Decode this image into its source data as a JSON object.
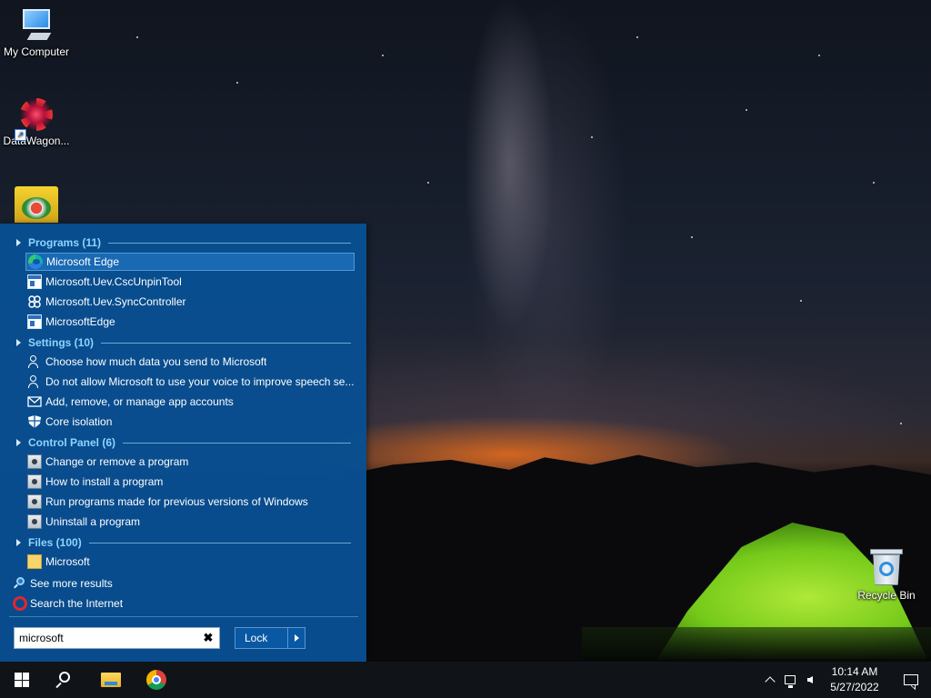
{
  "desktop": {
    "icons": [
      {
        "label": "My Computer",
        "icon": "computer-icon"
      },
      {
        "label": "DataWagon...",
        "icon": "datawagon-icon"
      },
      {
        "label": "",
        "icon": "app-shortcut-icon"
      },
      {
        "label": "Recycle Bin",
        "icon": "recycle-bin-icon"
      }
    ]
  },
  "start_menu": {
    "sections": [
      {
        "header": "Programs (11)",
        "items": [
          {
            "label": "Microsoft Edge",
            "icon": "edge-icon",
            "selected": true
          },
          {
            "label": "Microsoft.Uev.CscUnpinTool",
            "icon": "window-icon"
          },
          {
            "label": "Microsoft.Uev.SyncController",
            "icon": "sync-icon"
          },
          {
            "label": "MicrosoftEdge",
            "icon": "window-icon"
          }
        ]
      },
      {
        "header": "Settings (10)",
        "items": [
          {
            "label": "Choose how much data you send to Microsoft",
            "icon": "person-settings-icon"
          },
          {
            "label": "Do not allow Microsoft to use your voice to improve speech se...",
            "icon": "person-settings-icon"
          },
          {
            "label": "Add, remove, or manage app accounts",
            "icon": "mail-icon"
          },
          {
            "label": "Core isolation",
            "icon": "shield-icon"
          }
        ]
      },
      {
        "header": "Control Panel (6)",
        "items": [
          {
            "label": "Change or remove a program",
            "icon": "control-panel-icon"
          },
          {
            "label": "How to install a program",
            "icon": "control-panel-icon"
          },
          {
            "label": "Run programs made for previous versions of Windows",
            "icon": "control-panel-icon"
          },
          {
            "label": "Uninstall a program",
            "icon": "control-panel-icon"
          }
        ]
      },
      {
        "header": "Files (100)",
        "items": [
          {
            "label": "Microsoft",
            "icon": "folder-icon"
          }
        ]
      }
    ],
    "see_more": "See more results",
    "search_internet": "Search the Internet",
    "search": {
      "value": "microsoft",
      "clear_icon": "clear-icon"
    },
    "power_button": {
      "label": "Lock",
      "arrow_icon": "chevron-right-icon"
    }
  },
  "taskbar": {
    "buttons": [
      "start-icon",
      "search-icon",
      "file-explorer-icon",
      "chrome-icon"
    ],
    "tray": [
      "chevron-up-icon",
      "network-icon",
      "volume-icon"
    ],
    "time": "10:14 AM",
    "date": "5/27/2022",
    "notification_icon": "action-center-icon"
  }
}
